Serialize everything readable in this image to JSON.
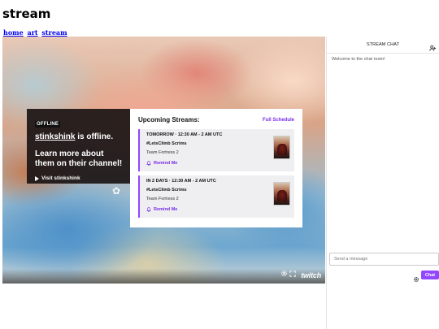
{
  "page": {
    "title": "stream"
  },
  "nav": [
    {
      "label": "home"
    },
    {
      "label": "art"
    },
    {
      "label": "stream"
    }
  ],
  "player": {
    "offline_badge": "OFFLINE",
    "channel_name": "stinkshink",
    "status_suffix": " is offline.",
    "promo_text": "Learn more about them on their channel!",
    "visit_label": "Visit stinkshink",
    "logo_text": "twitch",
    "icons": [
      "gear-icon",
      "fullscreen-icon",
      "twitch-logo"
    ]
  },
  "upcoming": {
    "title": "Upcoming Streams:",
    "full_schedule_label": "Full Schedule",
    "items": [
      {
        "time": "TOMORROW · 12:30 AM - 2 AM UTC",
        "name": "#LetsClimb Scrims",
        "game": "Team Fortress 2",
        "remind_label": "Remind Me"
      },
      {
        "time": "IN 2 DAYS · 12:30 AM - 2 AM UTC",
        "name": "#LetsClimb Scrims",
        "game": "Team Fortress 2",
        "remind_label": "Remind Me"
      }
    ]
  },
  "chat": {
    "title": "STREAM CHAT",
    "welcome": "Welcome to the chat room!",
    "input_placeholder": "Send a message",
    "send_label": "Chat"
  },
  "colors": {
    "accent": "#9147ff",
    "link": "#772ce8",
    "nav_link": "#0000ee"
  }
}
